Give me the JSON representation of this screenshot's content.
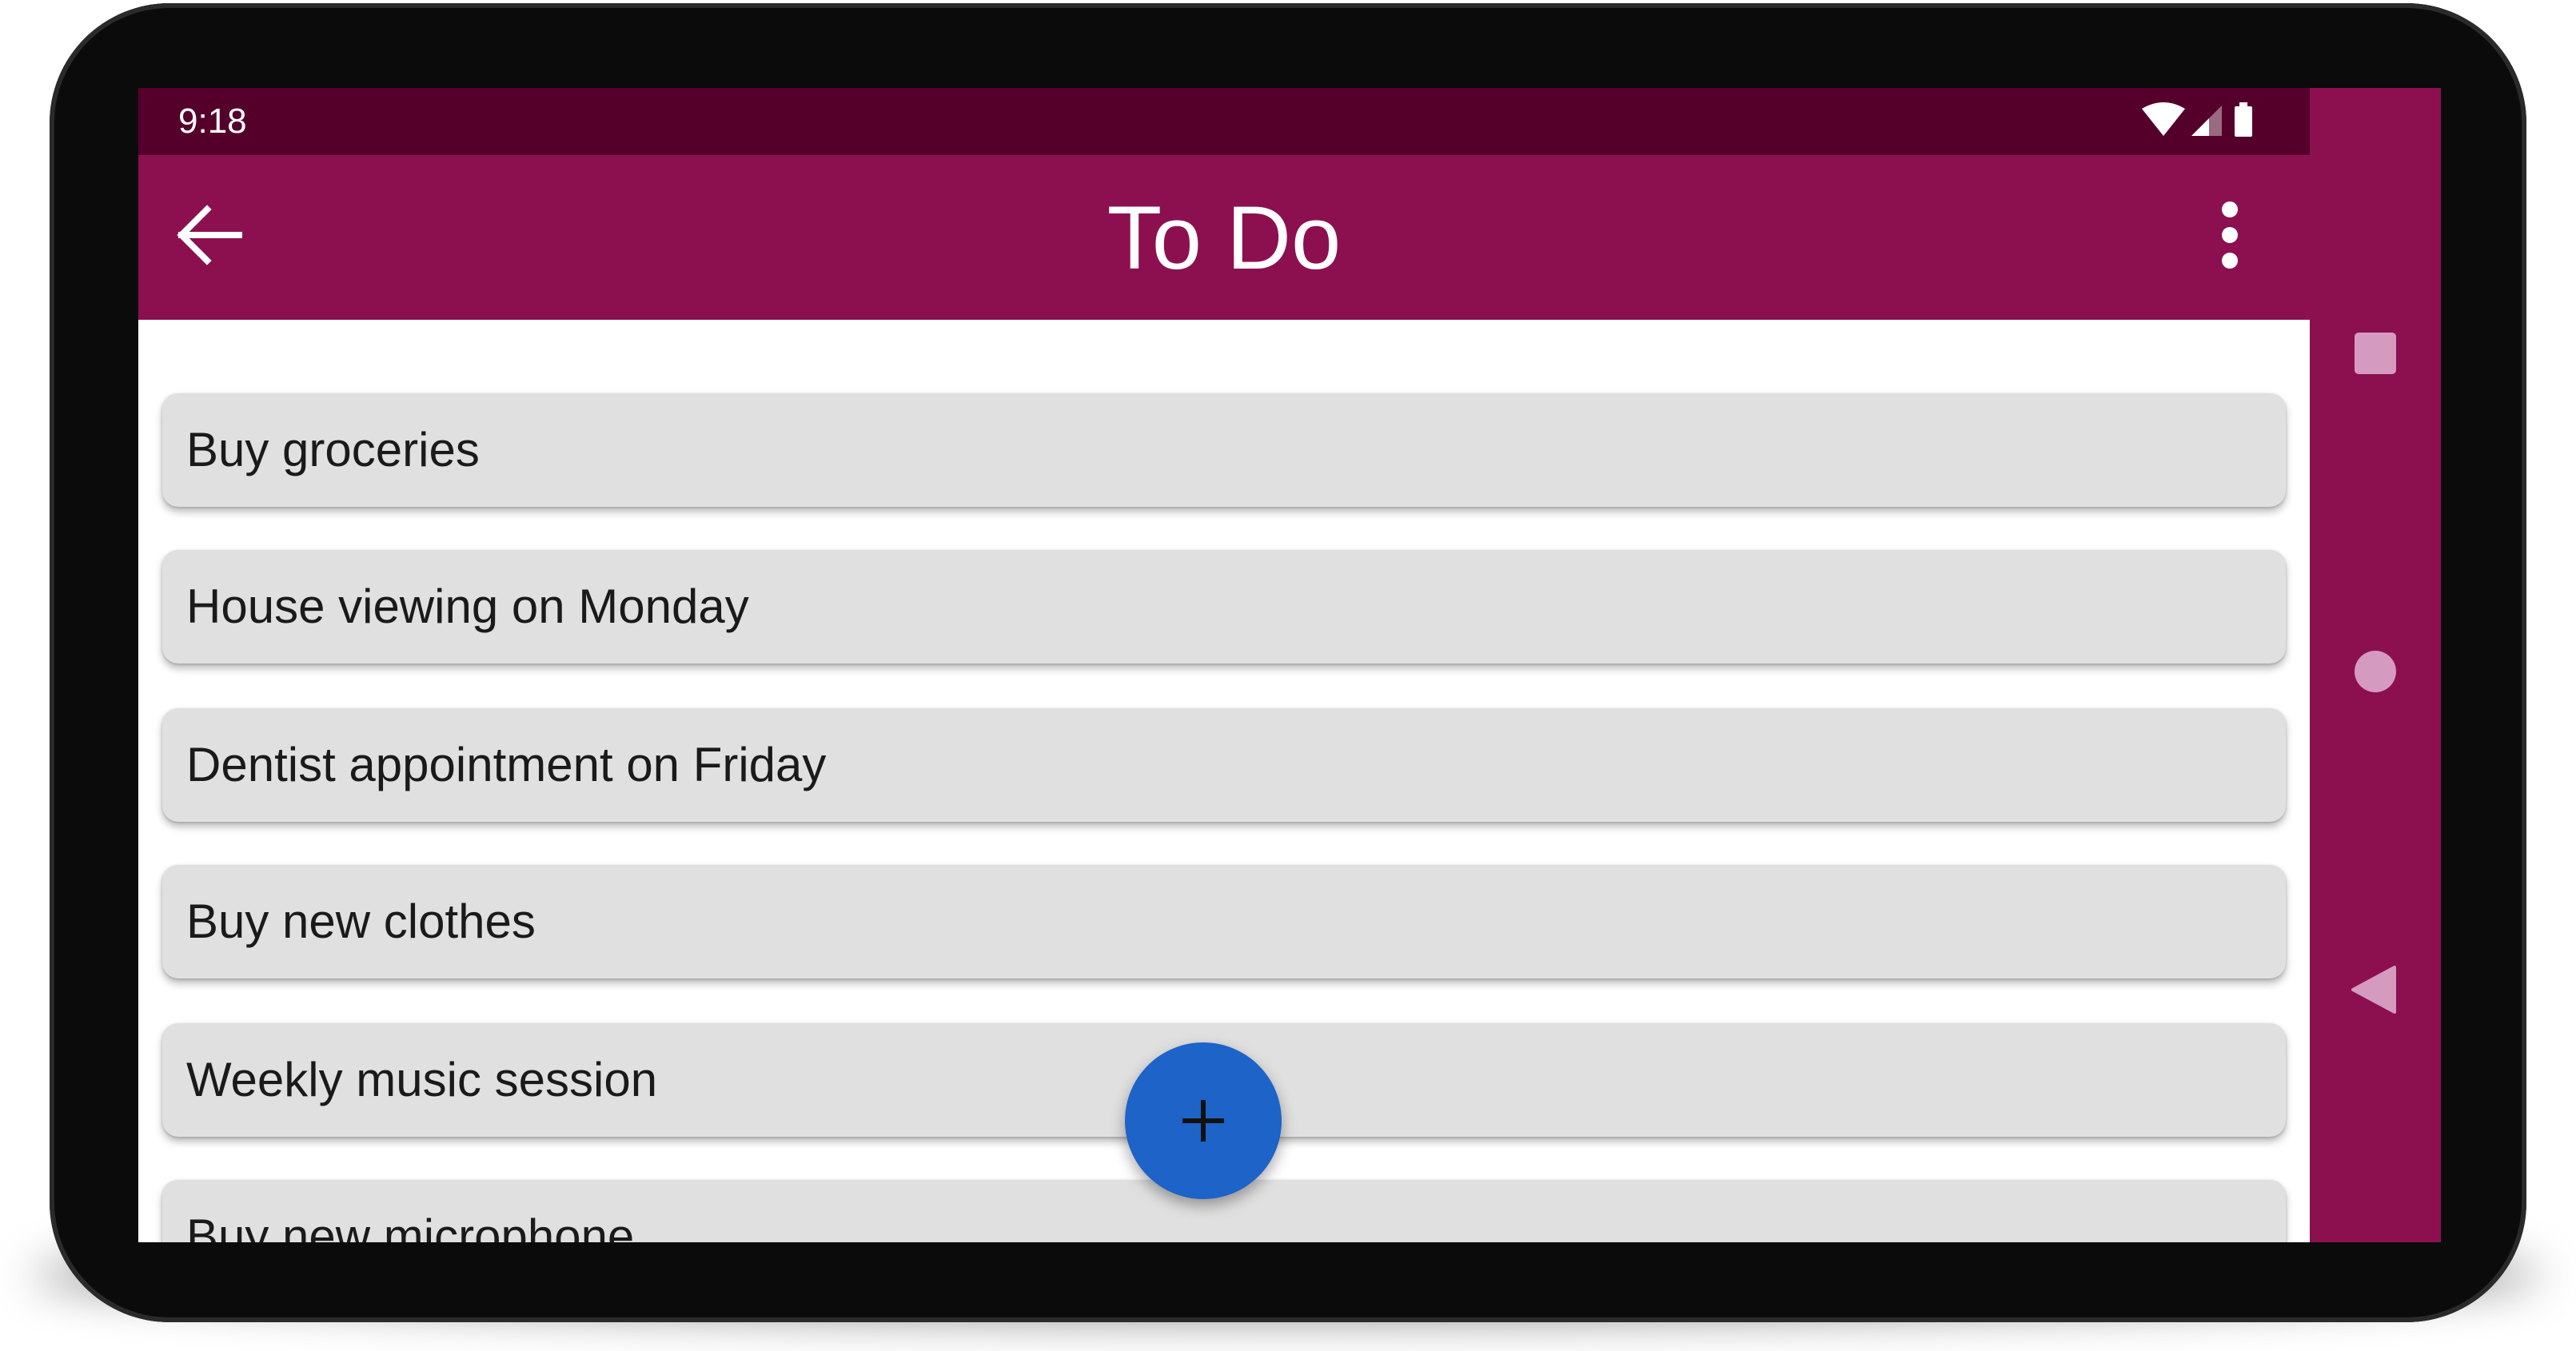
{
  "status_bar": {
    "time": "9:18",
    "icons": [
      "wifi-icon",
      "cell-signal-icon",
      "battery-icon"
    ]
  },
  "app_bar": {
    "title": "To Do",
    "back_icon": "arrow-back-icon",
    "menu_icon": "more-vert-icon"
  },
  "todo_list": {
    "items": [
      {
        "label": "Buy groceries"
      },
      {
        "label": "House viewing on Monday"
      },
      {
        "label": "Dentist appointment on Friday"
      },
      {
        "label": "Buy new clothes"
      },
      {
        "label": "Weekly music session"
      },
      {
        "label": "Buy new microphone"
      }
    ]
  },
  "fab": {
    "icon": "plus-icon"
  },
  "nav_bar": {
    "buttons": [
      "recents-square-icon",
      "home-circle-icon",
      "back-triangle-icon"
    ]
  },
  "colors": {
    "status_bar": "#55002a",
    "app_bar": "#8c1050",
    "list_item": "#e0e0e0",
    "fab": "#1d63c8",
    "nav_icon": "#d59ac0"
  }
}
